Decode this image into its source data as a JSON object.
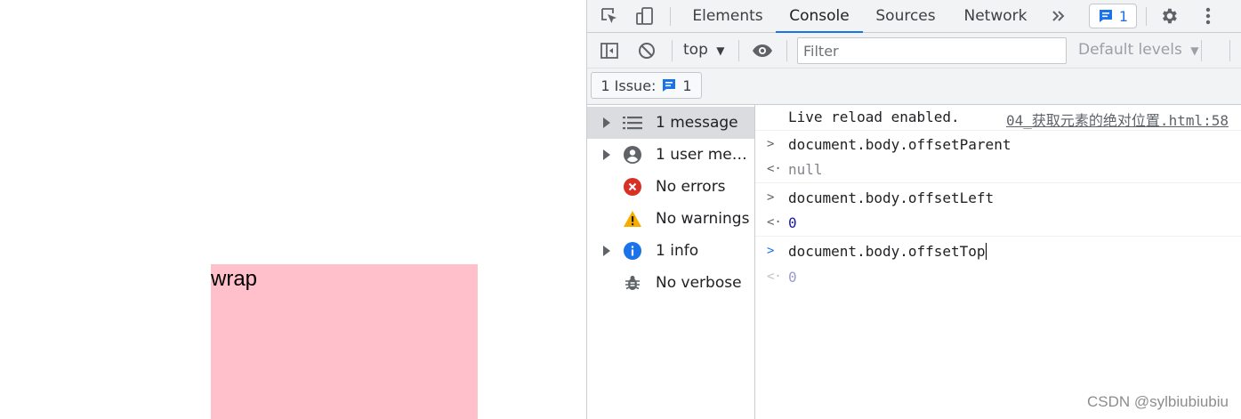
{
  "page": {
    "wrap_text": "wrap",
    "wrap_color": "#ffc0cb"
  },
  "devtools": {
    "tabs": [
      {
        "label": "Elements",
        "active": false
      },
      {
        "label": "Console",
        "active": true
      },
      {
        "label": "Sources",
        "active": false
      },
      {
        "label": "Network",
        "active": false
      }
    ],
    "more_tabs_icon": "double-chevron-icon",
    "issues_count": "1",
    "toolbar": {
      "context": "top",
      "filter_placeholder": "Filter",
      "default_levels": "Default levels"
    },
    "issue_button": {
      "label": "1 Issue:",
      "count": "1"
    },
    "sidebar": [
      {
        "label": "1 message",
        "icon": "list-icon",
        "expandable": true,
        "selected": true
      },
      {
        "label": "1 user mess...",
        "icon": "user-icon",
        "expandable": true,
        "selected": false
      },
      {
        "label": "No errors",
        "icon": "error-icon",
        "expandable": false,
        "selected": false
      },
      {
        "label": "No warnings",
        "icon": "warning-icon",
        "expandable": false,
        "selected": false
      },
      {
        "label": "1 info",
        "icon": "info-icon",
        "expandable": true,
        "selected": false
      },
      {
        "label": "No verbose",
        "icon": "bug-icon",
        "expandable": false,
        "selected": false
      }
    ],
    "console": {
      "log_message": "Live reload enabled.",
      "log_source": "04_获取元素的绝对位置.html:58",
      "entries": [
        {
          "input": "document.body.offsetParent",
          "output": "null"
        },
        {
          "input": "document.body.offsetLeft",
          "output": "0"
        },
        {
          "input": "document.body.offsetTop",
          "output": "0"
        }
      ]
    },
    "colors": {
      "accent": "#1a73e8",
      "error": "#d93025",
      "warning": "#f9ab00",
      "info": "#1a73e8"
    }
  },
  "watermark": "CSDN @sylbiubiubiu"
}
